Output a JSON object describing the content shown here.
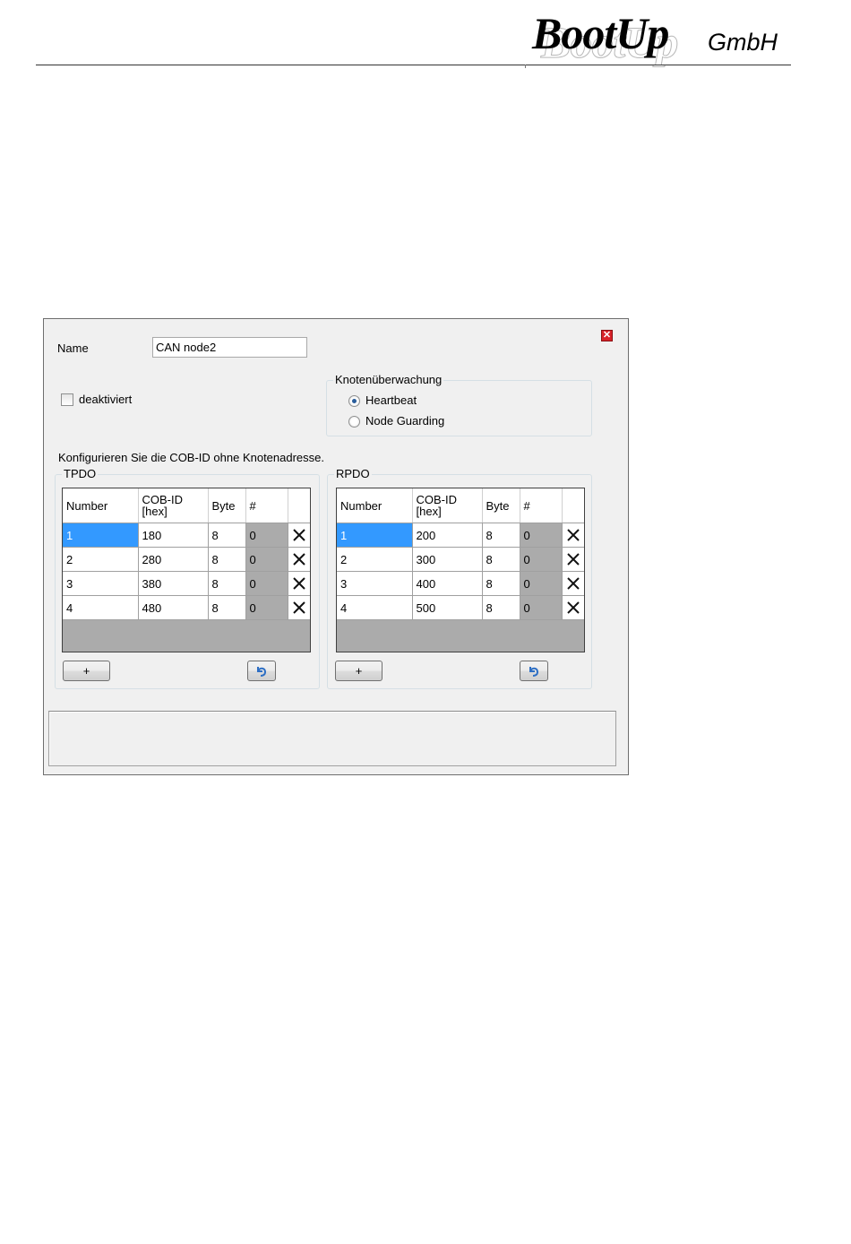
{
  "logo": {
    "brand": "BootUp",
    "suffix": "GmbH"
  },
  "dialog": {
    "name_label": "Name",
    "name_value": "CAN node2",
    "deactivated_label": "deaktiviert",
    "monitoring": {
      "title": "Knotenüberwachung",
      "options": [
        {
          "label": "Heartbeat",
          "selected": true
        },
        {
          "label": "Node Guarding",
          "selected": false
        }
      ]
    },
    "hint": "Konfigurieren Sie die COB-ID ohne Knotenadresse.",
    "columns": {
      "number": "Number",
      "cob_id_1": "COB-ID",
      "cob_id_2": "[hex]",
      "byte": "Byte",
      "count": "#"
    },
    "tpdo": {
      "title": "TPDO",
      "rows": [
        {
          "number": "1",
          "cob_id": "180",
          "byte": "8",
          "count": "0"
        },
        {
          "number": "2",
          "cob_id": "280",
          "byte": "8",
          "count": "0"
        },
        {
          "number": "3",
          "cob_id": "380",
          "byte": "8",
          "count": "0"
        },
        {
          "number": "4",
          "cob_id": "480",
          "byte": "8",
          "count": "0"
        }
      ]
    },
    "rpdo": {
      "title": "RPDO",
      "rows": [
        {
          "number": "1",
          "cob_id": "200",
          "byte": "8",
          "count": "0"
        },
        {
          "number": "2",
          "cob_id": "300",
          "byte": "8",
          "count": "0"
        },
        {
          "number": "3",
          "cob_id": "400",
          "byte": "8",
          "count": "0"
        },
        {
          "number": "4",
          "cob_id": "500",
          "byte": "8",
          "count": "0"
        }
      ]
    },
    "add_button_label": "+",
    "status_text": ""
  },
  "colors": {
    "selection": "#3399ff",
    "close": "#d8232a",
    "undo_icon": "#2e6fc4"
  }
}
